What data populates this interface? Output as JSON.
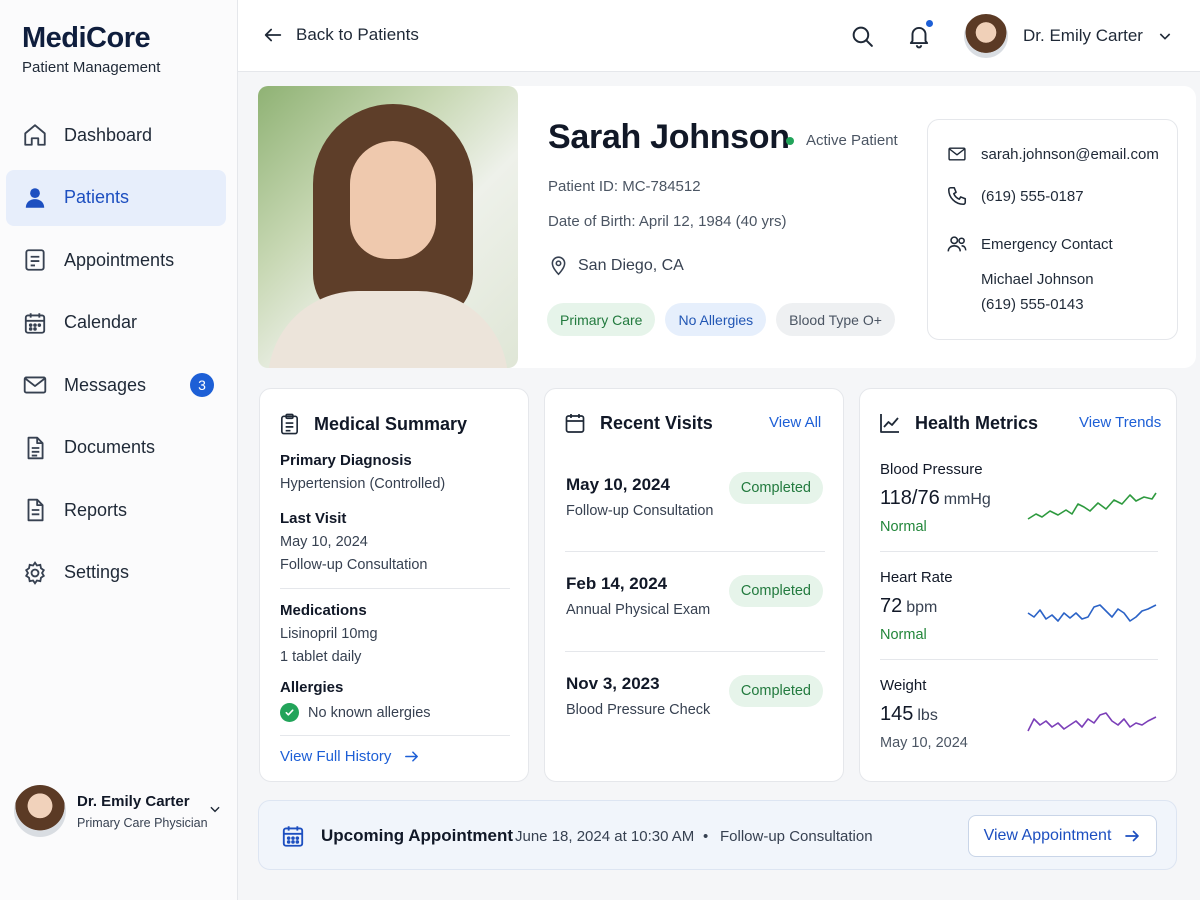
{
  "brand": {
    "name": "MediCore",
    "subtitle": "Patient Management"
  },
  "sidebar": {
    "items": [
      {
        "label": "Dashboard",
        "icon": "home-icon",
        "active": false
      },
      {
        "label": "Patients",
        "icon": "user-icon",
        "active": true
      },
      {
        "label": "Appointments",
        "icon": "clipboard-icon",
        "active": false
      },
      {
        "label": "Calendar",
        "icon": "calendar-icon",
        "active": false
      },
      {
        "label": "Messages",
        "icon": "mail-icon",
        "active": false,
        "badge": "3"
      },
      {
        "label": "Documents",
        "icon": "document-icon",
        "active": false
      },
      {
        "label": "Reports",
        "icon": "report-icon",
        "active": false
      },
      {
        "label": "Settings",
        "icon": "gear-icon",
        "active": false
      }
    ],
    "user": {
      "name": "Dr. Emily Carter",
      "role": "Primary Care Physician"
    }
  },
  "topbar": {
    "back_label": "Back to Patients",
    "user_name": "Dr. Emily Carter",
    "notification_dot_color": "#1d5fd6"
  },
  "patient": {
    "name": "Sarah Johnson",
    "status": "Active Patient",
    "id_line": "Patient ID: MC-784512",
    "dob_line": "Date of Birth: April 12, 1984 (40 yrs)",
    "location": "San Diego, CA",
    "tags": [
      "Primary Care",
      "No Allergies",
      "Blood Type O+"
    ],
    "contact": {
      "email": "sarah.johnson@email.com",
      "phone": "(619) 555-0187",
      "emergency_label": "Emergency Contact",
      "emergency_name": "Michael Johnson",
      "emergency_phone": "(619) 555-0143"
    }
  },
  "medical_summary": {
    "title": "Medical Summary",
    "diagnosis_label": "Primary Diagnosis",
    "diagnosis": "Hypertension (Controlled)",
    "last_visit_label": "Last Visit",
    "last_visit_date": "May 10, 2024",
    "last_visit_type": "Follow-up Consultation",
    "medications_label": "Medications",
    "medication_name": "Lisinopril 10mg",
    "medication_dose": "1 tablet daily",
    "allergies_label": "Allergies",
    "allergies_value": "No known allergies",
    "history_link": "View Full History"
  },
  "recent_visits": {
    "title": "Recent Visits",
    "link": "View All",
    "visits": [
      {
        "date": "May 10, 2024",
        "type": "Follow-up Consultation",
        "status": "Completed"
      },
      {
        "date": "Feb 14, 2024",
        "type": "Annual Physical Exam",
        "status": "Completed"
      },
      {
        "date": "Nov 3, 2023",
        "type": "Blood Pressure Check",
        "status": "Completed"
      }
    ]
  },
  "health_metrics": {
    "title": "Health Metrics",
    "link": "View Trends",
    "metrics": [
      {
        "label": "Blood Pressure",
        "value": "118/76",
        "unit": "mmHg",
        "status": "Normal",
        "status_color": "#22863a",
        "line_color": "#2e9a3f"
      },
      {
        "label": "Heart Rate",
        "value": "72",
        "unit": "bpm",
        "status": "Normal",
        "status_color": "#22863a",
        "line_color": "#2b63c7"
      },
      {
        "label": "Weight",
        "value": "145",
        "unit": "lbs",
        "status": "May 10, 2024",
        "status_color": "#4b5563",
        "line_color": "#7b3fb8"
      }
    ]
  },
  "upcoming": {
    "title": "Upcoming Appointment",
    "time": "June 18, 2024 at 10:30 AM",
    "separator": "•",
    "type": "Follow-up Consultation",
    "button": "View Appointment"
  }
}
